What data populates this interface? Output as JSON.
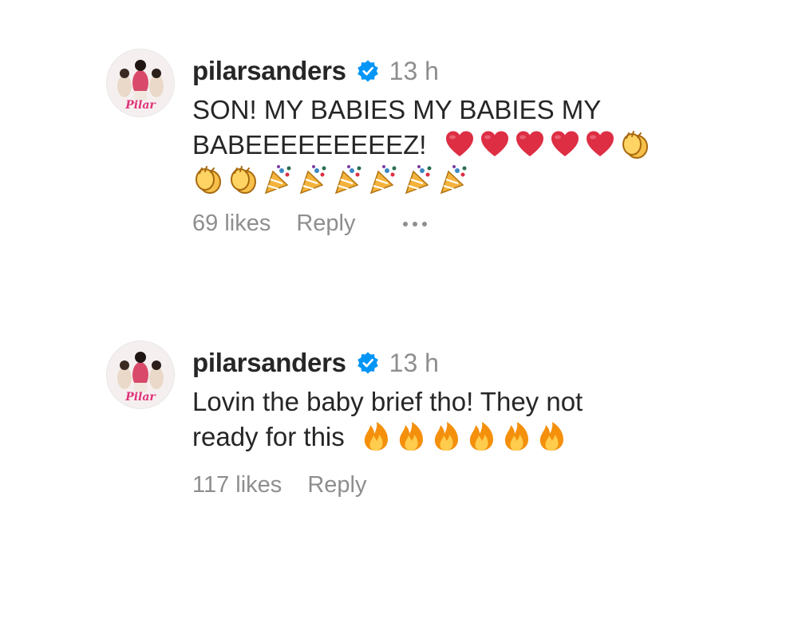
{
  "comments": [
    {
      "username": "pilarsanders",
      "time": "13 h",
      "text_line1": "SON! MY BABIES MY BABIES MY",
      "text_line2": "BABEEEEEEEEEZ!",
      "emojis_line2": [
        "red-heart",
        "red-heart",
        "red-heart",
        "red-heart",
        "red-heart",
        "clapping-hands"
      ],
      "emojis_line3": [
        "clapping-hands",
        "clapping-hands",
        "party-popper",
        "party-popper",
        "party-popper",
        "party-popper",
        "party-popper",
        "party-popper"
      ],
      "likes": "69 likes",
      "reply": "Reply"
    },
    {
      "username": "pilarsanders",
      "time": "13 h",
      "text_line1": "Lovin the baby brief tho! They not",
      "text_line2": "ready for this",
      "emojis_line2": [
        "fire",
        "fire",
        "fire",
        "fire",
        "fire",
        "fire"
      ],
      "likes": "117 likes",
      "reply": "Reply"
    }
  ],
  "avatar_text": "Pilar",
  "colors": {
    "username": "#262626",
    "muted": "#8e8e8e",
    "verified": "#0095f6",
    "avatar_brand": "#e0337a"
  }
}
